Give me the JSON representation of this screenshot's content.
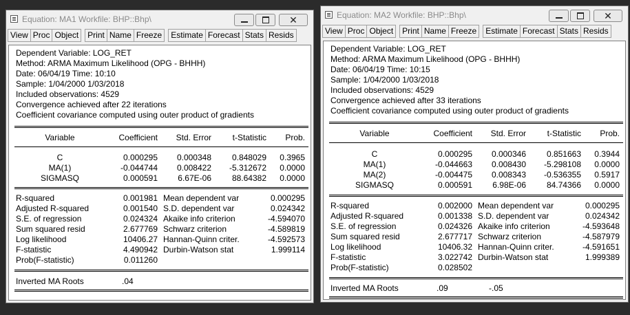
{
  "toolbar": [
    "View",
    "Proc",
    "Object",
    "Print",
    "Name",
    "Freeze",
    "Estimate",
    "Forecast",
    "Stats",
    "Resids"
  ],
  "windows": [
    {
      "title": "Equation: MA1   Workfile: BHP::Bhp\\",
      "header": [
        "Dependent Variable: LOG_RET",
        "Method: ARMA Maximum Likelihood (OPG - BHHH)",
        "Date: 06/04/19   Time: 10:10",
        "Sample: 1/04/2000 1/03/2018",
        "Included observations: 4529",
        "Convergence achieved after 22 iterations",
        "Coefficient covariance computed using outer product of gradients"
      ],
      "columns": [
        "Variable",
        "Coefficient",
        "Std. Error",
        "t-Statistic",
        "Prob."
      ],
      "rows": [
        [
          "C",
          "0.000295",
          "0.000348",
          "0.848029",
          "0.3965"
        ],
        [
          "MA(1)",
          "-0.044744",
          "0.008422",
          "-5.312672",
          "0.0000"
        ],
        [
          "SIGMASQ",
          "0.000591",
          "6.67E-06",
          "88.64382",
          "0.0000"
        ]
      ],
      "stats": [
        [
          "R-squared",
          "0.001981",
          "Mean dependent var",
          "0.000295"
        ],
        [
          "Adjusted R-squared",
          "0.001540",
          "S.D. dependent var",
          "0.024342"
        ],
        [
          "S.E. of regression",
          "0.024324",
          "Akaike info criterion",
          "-4.594070"
        ],
        [
          "Sum squared resid",
          "2.677769",
          "Schwarz criterion",
          "-4.589819"
        ],
        [
          "Log likelihood",
          "10406.27",
          "Hannan-Quinn criter.",
          "-4.592573"
        ],
        [
          "F-statistic",
          "4.490942",
          "Durbin-Watson stat",
          "1.999114"
        ],
        [
          "Prob(F-statistic)",
          "0.011260",
          "",
          ""
        ]
      ],
      "roots_label": "Inverted MA Roots",
      "roots": [
        ".04"
      ]
    },
    {
      "title": "Equation: MA2   Workfile: BHP::Bhp\\",
      "header": [
        "Dependent Variable: LOG_RET",
        "Method: ARMA Maximum Likelihood (OPG - BHHH)",
        "Date: 06/04/19   Time: 10:15",
        "Sample: 1/04/2000 1/03/2018",
        "Included observations: 4529",
        "Convergence achieved after 33 iterations",
        "Coefficient covariance computed using outer product of gradients"
      ],
      "columns": [
        "Variable",
        "Coefficient",
        "Std. Error",
        "t-Statistic",
        "Prob."
      ],
      "rows": [
        [
          "C",
          "0.000295",
          "0.000346",
          "0.851663",
          "0.3944"
        ],
        [
          "MA(1)",
          "-0.044663",
          "0.008430",
          "-5.298108",
          "0.0000"
        ],
        [
          "MA(2)",
          "-0.004475",
          "0.008343",
          "-0.536355",
          "0.5917"
        ],
        [
          "SIGMASQ",
          "0.000591",
          "6.98E-06",
          "84.74366",
          "0.0000"
        ]
      ],
      "stats": [
        [
          "R-squared",
          "0.002000",
          "Mean dependent var",
          "0.000295"
        ],
        [
          "Adjusted R-squared",
          "0.001338",
          "S.D. dependent var",
          "0.024342"
        ],
        [
          "S.E. of regression",
          "0.024326",
          "Akaike info criterion",
          "-4.593648"
        ],
        [
          "Sum squared resid",
          "2.677717",
          "Schwarz criterion",
          "-4.587979"
        ],
        [
          "Log likelihood",
          "10406.32",
          "Hannan-Quinn criter.",
          "-4.591651"
        ],
        [
          "F-statistic",
          "3.022742",
          "Durbin-Watson stat",
          "1.999389"
        ],
        [
          "Prob(F-statistic)",
          "0.028502",
          "",
          ""
        ]
      ],
      "roots_label": "Inverted MA Roots",
      "roots": [
        ".09",
        "-.05"
      ]
    }
  ]
}
